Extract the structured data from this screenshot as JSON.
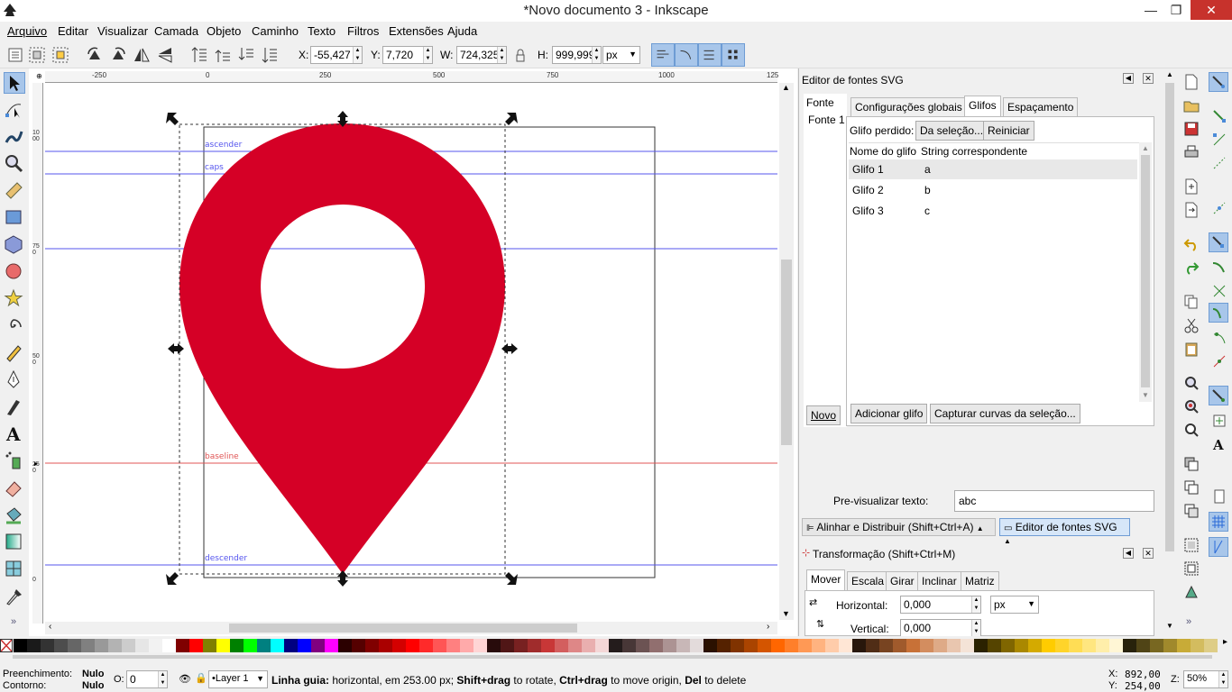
{
  "window": {
    "title": "*Novo documento 3 - Inkscape",
    "min": "—",
    "restore": "❐",
    "close": "✕"
  },
  "menu": [
    "Arquivo",
    "Editar",
    "Visualizar",
    "Camada",
    "Objeto",
    "Caminho",
    "Texto",
    "Filtros",
    "Extensões",
    "Ajuda"
  ],
  "controls": {
    "x_label": "X:",
    "x_value": "-55,427",
    "y_label": "Y:",
    "y_value": "7,720",
    "w_label": "W:",
    "w_value": "724,325",
    "h_label": "H:",
    "h_value": "999,999",
    "unit": "px"
  },
  "ruler": {
    "h_ticks": [
      "-250",
      "0",
      "250",
      "500",
      "750",
      "1000",
      "125"
    ],
    "v_ticks": [
      "1000",
      "750",
      "500",
      "250",
      "0"
    ]
  },
  "guides": {
    "ascender": "ascender",
    "caps": "caps",
    "xheight": "x-height",
    "baseline": "baseline",
    "descender": "descender"
  },
  "panel": {
    "title": "Editor de fontes SVG",
    "font_header": "Fonte",
    "font_item": "Fonte 1",
    "tabs": [
      "Configurações globais",
      "Glifos",
      "Espaçamento"
    ],
    "missing_label": "Glifo perdido:",
    "from_selection": "Da seleção...",
    "reset": "Reiniciar",
    "col_name": "Nome do glifo",
    "col_string": "String correspondente",
    "glyphs": [
      {
        "name": "Glifo 1",
        "str": "a"
      },
      {
        "name": "Glifo 2",
        "str": "b"
      },
      {
        "name": "Glifo 3",
        "str": "c"
      }
    ],
    "new_button": "Novo",
    "add_glyph": "Adicionar glifo",
    "capture": "Capturar curvas da seleção...",
    "preview_label": "Pre-visualizar texto:",
    "preview_value": "abc",
    "dock_tab1": "Alinhar e Distribuir (Shift+Ctrl+A)",
    "dock_tab2": "Editor de fontes SVG",
    "transform_title": "Transformação (Shift+Ctrl+M)",
    "t_tabs": [
      "Mover",
      "Escala",
      "Girar",
      "Inclinar",
      "Matriz"
    ],
    "horizontal_label": "Horizontal:",
    "horizontal_value": "0,000",
    "vertical_label": "Vertical:",
    "vertical_value": "0,000",
    "t_unit": "px"
  },
  "colors": {
    "pin": "#d50026",
    "guide_blue": "#5555ee",
    "guide_red": "#e05555",
    "accent": "#a8c6ea"
  },
  "status": {
    "fill_label": "Preenchimento:",
    "fill_value": "Nulo",
    "stroke_label": "Contorno:",
    "stroke_value": "Nulo",
    "opacity_label": "O:",
    "opacity_value": "0",
    "layer": "•Layer 1",
    "msg_bold1": "Linha guia:",
    "msg1": " horizontal, em 253.00 px; ",
    "msg_bold2": "Shift+drag",
    "msg2": " to rotate, ",
    "msg_bold3": "Ctrl+drag",
    "msg3": " to move origin, ",
    "msg_bold4": "Del",
    "msg4": " to delete",
    "x_label": "X:",
    "x_value": "892,00",
    "y_label": "Y:",
    "y_value": "254,00",
    "zoom_label": "Z:",
    "zoom_value": "50%"
  },
  "palette": [
    "#000000",
    "#1a1a1a",
    "#333333",
    "#4d4d4d",
    "#666666",
    "#808080",
    "#999999",
    "#b3b3b3",
    "#cccccc",
    "#e6e6e6",
    "#f2f2f2",
    "#ffffff",
    "#800000",
    "#ff0000",
    "#808000",
    "#ffff00",
    "#008000",
    "#00ff00",
    "#008080",
    "#00ffff",
    "#000080",
    "#0000ff",
    "#800080",
    "#ff00ff",
    "#2b0000",
    "#550000",
    "#800000",
    "#aa0000",
    "#d40000",
    "#ff0000",
    "#ff2a2a",
    "#ff5555",
    "#ff8080",
    "#ffaaaa",
    "#ffd5d5",
    "#280b0b",
    "#501616",
    "#782121",
    "#a02c2c",
    "#c83737",
    "#d35f5f",
    "#de8787",
    "#e9afaf",
    "#f4d7d7",
    "#241c1c",
    "#483737",
    "#6c5353",
    "#916f6f",
    "#ac9393",
    "#c8b7b7",
    "#e3dbdb",
    "#2b1100",
    "#552200",
    "#803300",
    "#aa4400",
    "#d45500",
    "#ff6600",
    "#ff7f2a",
    "#ff9955",
    "#ffb380",
    "#ffccaa",
    "#ffe6d5",
    "#28170b",
    "#502d16",
    "#784421",
    "#a05a2c",
    "#c87137",
    "#d38d5f",
    "#deaa87",
    "#e9c6af",
    "#f4e3d7",
    "#2b2200",
    "#554400",
    "#806600",
    "#aa8800",
    "#d4aa00",
    "#ffcc00",
    "#ffd42a",
    "#ffdd55",
    "#ffe680",
    "#ffeeaa",
    "#fff6d5",
    "#28220b",
    "#504416",
    "#786721",
    "#a0892c",
    "#c8ab37",
    "#d3bc5f",
    "#decd87",
    "#e9ddaf",
    "#f4eed7",
    "#2b2b00",
    "#555500",
    "#808000",
    "#aaaa00",
    "#d4d400",
    "#ffff00"
  ]
}
